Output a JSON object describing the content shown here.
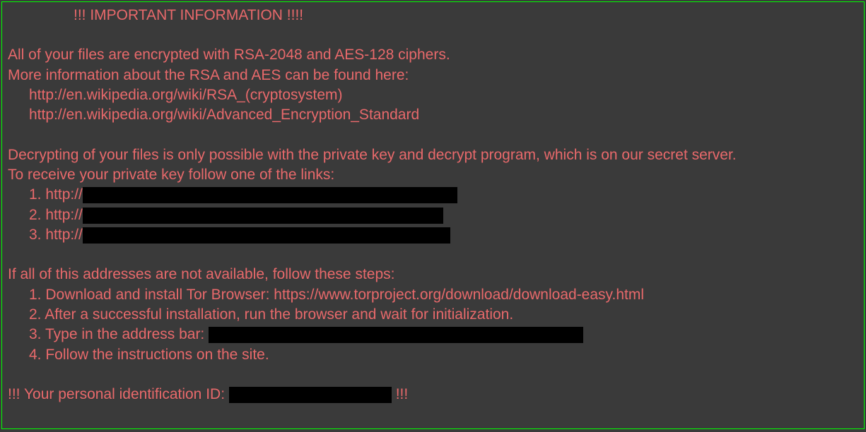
{
  "header": "!!! IMPORTANT INFORMATION !!!!",
  "line_encrypted": "All of your files are encrypted with RSA-2048 and AES-128 ciphers.",
  "line_moreinfo": "More information about the RSA and AES can be found here:",
  "link_rsa": "http://en.wikipedia.org/wiki/RSA_(cryptosystem)",
  "link_aes": "http://en.wikipedia.org/wiki/Advanced_Encryption_Standard",
  "line_decrypt": "Decrypting of your files is only possible with the private key and decrypt program, which is on our secret server.",
  "line_receive": "To receive your private key follow one of the links:",
  "link1_prefix": "1. http://",
  "link2_prefix": "2. http://",
  "link3_prefix": "3. http://",
  "line_unavailable": "If all of this addresses are not available, follow these steps:",
  "step1": "1. Download and install Tor Browser: https://www.torproject.org/download/download-easy.html",
  "step2": "2. After a successful installation, run the browser and wait for initialization.",
  "step3_prefix": "3. Type in the address bar: ",
  "step4": "4. Follow the instructions on the site.",
  "id_prefix": "!!! Your personal identification ID: ",
  "id_suffix": " !!!"
}
